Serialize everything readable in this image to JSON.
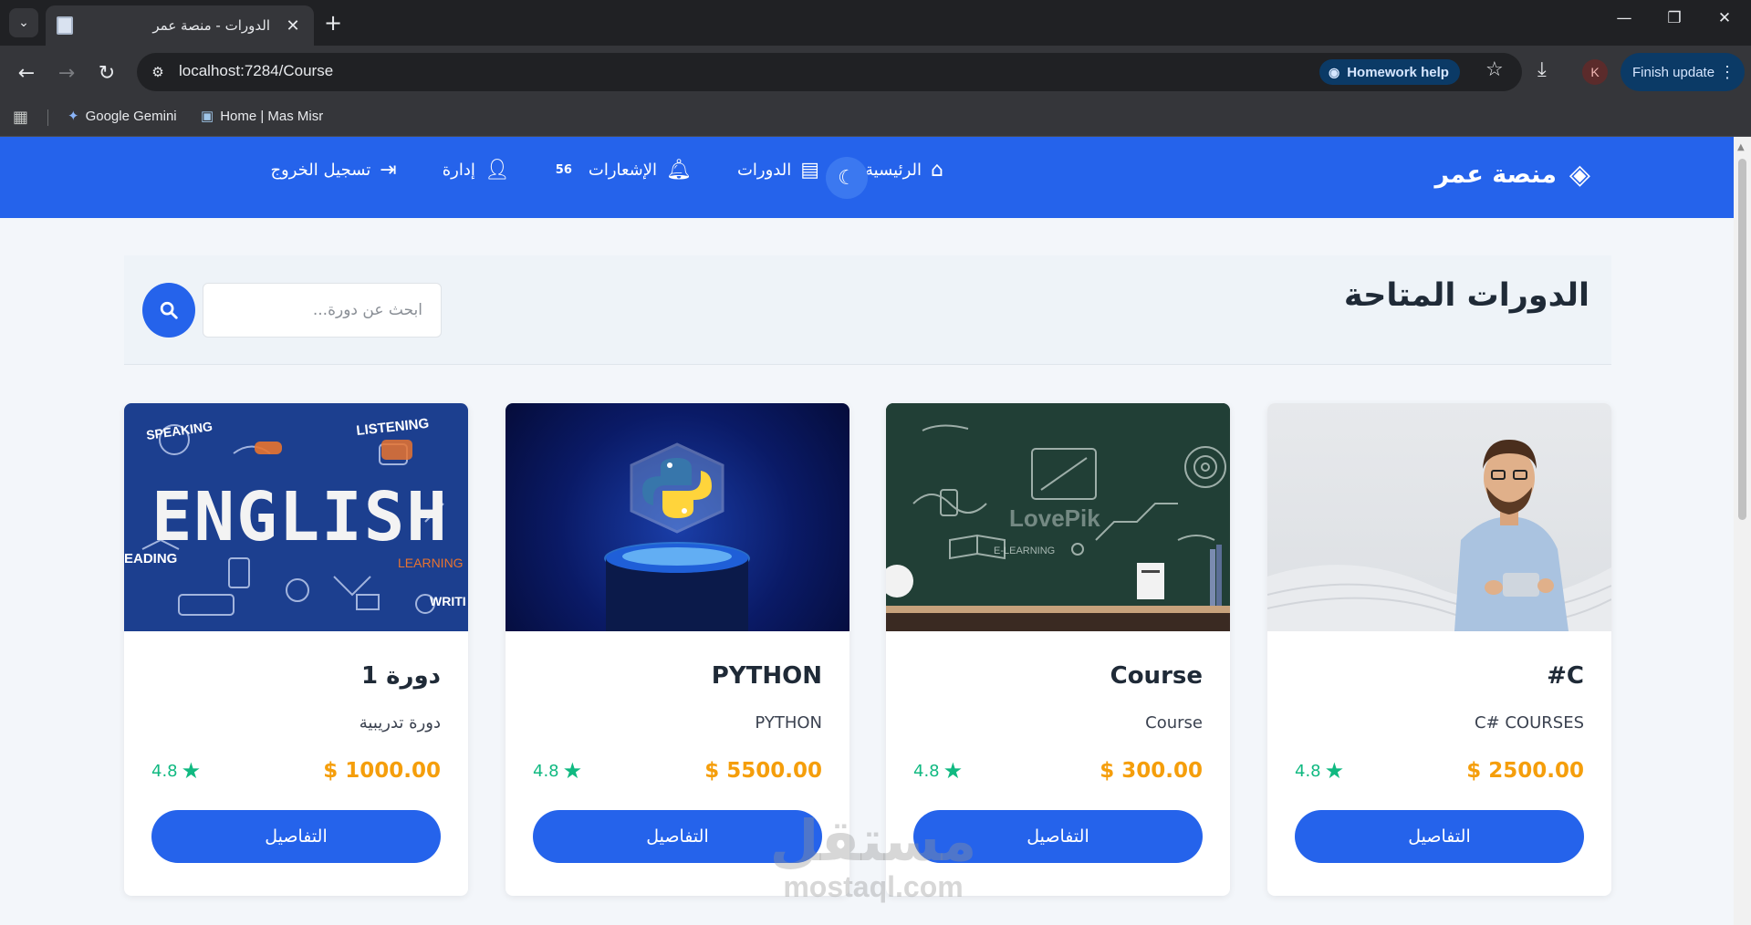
{
  "browser": {
    "tab_title": "الدورات - منصة عمر",
    "url": "localhost:7284/Course",
    "homework_help": "Homework help",
    "finish_update": "Finish update",
    "avatar_letter": "K",
    "bookmarks": [
      {
        "label": "Google Gemini"
      },
      {
        "label": "Home | Mas Misr"
      }
    ]
  },
  "site": {
    "brand": "منصة عمر",
    "nav": {
      "home": "الرئيسية",
      "courses": "الدورات",
      "notifications": "الإشعارات",
      "notifications_count": "56",
      "admin": "إدارة",
      "logout": "تسجيل الخروج"
    }
  },
  "page": {
    "title": "الدورات المتاحة",
    "search_placeholder": "ابحث عن دورة..."
  },
  "courses": [
    {
      "title": "C#",
      "description": "C# COURSES",
      "price": "$ 2500.00",
      "rating": "4.8",
      "button": "التفاصيل"
    },
    {
      "title": "Course",
      "description": "Course",
      "price": "$ 300.00",
      "rating": "4.8",
      "button": "التفاصيل"
    },
    {
      "title": "PYTHON",
      "description": "PYTHON",
      "price": "$ 5500.00",
      "rating": "4.8",
      "button": "التفاصيل"
    },
    {
      "title": "دورة 1",
      "description": "دورة تدريبية",
      "price": "$ 1000.00",
      "rating": "4.8",
      "button": "التفاصيل"
    }
  ],
  "images": {
    "english_word": "ENGLISH",
    "speaking": "SPEAKING",
    "listening": "LISTENING",
    "reading": "EADING",
    "learning": "LEARNING",
    "writing": "WRITI",
    "elearning": "E-LEARNING",
    "lovepik": "LovePik"
  },
  "watermark": {
    "arabic": "مستقل",
    "latin": "mostaql.com"
  },
  "colors": {
    "primary": "#2563eb",
    "price": "#f59e0b",
    "rating": "#10b981"
  }
}
